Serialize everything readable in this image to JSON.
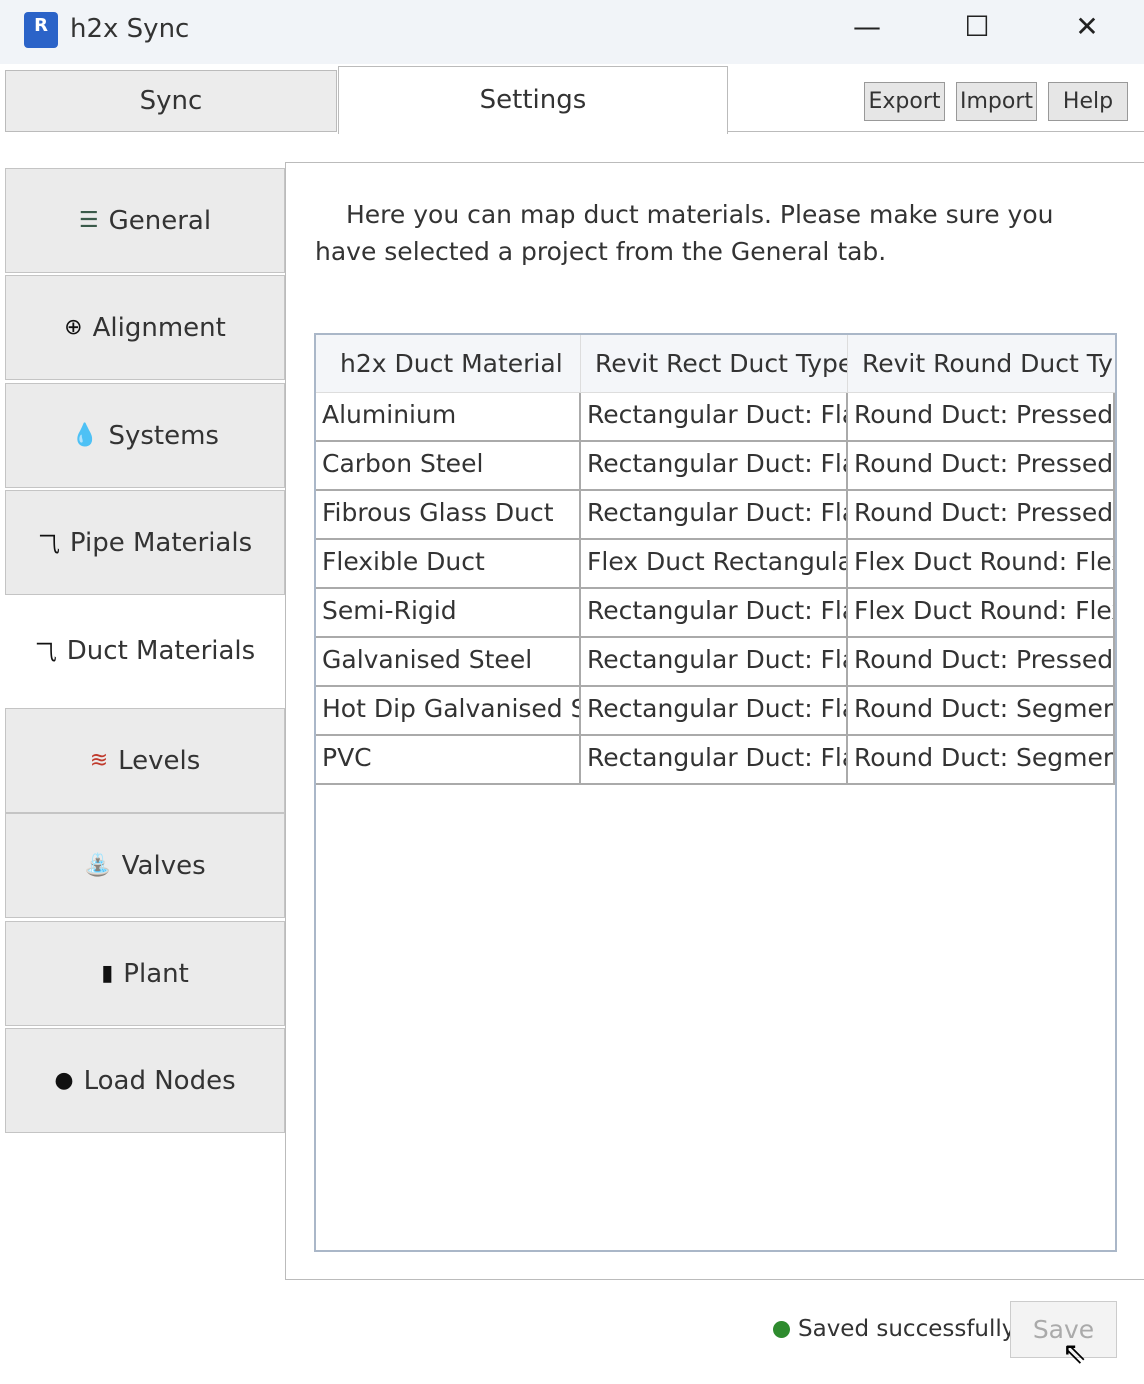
{
  "window": {
    "title": "h2x Sync",
    "app_icon_letter": "R",
    "minimize": "—",
    "maximize": "☐",
    "close": "✕"
  },
  "tabs": [
    {
      "label": "Sync"
    },
    {
      "label": "Settings"
    }
  ],
  "toolbar": {
    "export": "Export",
    "import": "Import",
    "help": "Help"
  },
  "nav": [
    {
      "label": "General",
      "icon": "server-icon",
      "glyph": "☰",
      "color": "#3a5a4a"
    },
    {
      "label": "Alignment",
      "icon": "crosshair-icon",
      "glyph": "⊕",
      "color": "#111"
    },
    {
      "label": "Systems",
      "icon": "water-drop-icon",
      "glyph": "💧",
      "color": "#1a2ee0"
    },
    {
      "label": "Pipe Materials",
      "icon": "pulse-icon",
      "glyph": "⺄",
      "color": "#111"
    },
    {
      "label": "Duct Materials",
      "icon": "pulse-icon",
      "glyph": "⺄",
      "color": "#111"
    },
    {
      "label": "Levels",
      "icon": "layers-icon",
      "glyph": "≋",
      "color": "#c0392b"
    },
    {
      "label": "Valves",
      "icon": "faucet-icon",
      "glyph": "⛲",
      "color": "#111"
    },
    {
      "label": "Plant",
      "icon": "bucket-icon",
      "glyph": "▮",
      "color": "#111"
    },
    {
      "label": "Load Nodes",
      "icon": "circle-icon",
      "glyph": "●",
      "color": "#111"
    }
  ],
  "main": {
    "intro": "Here you can map duct materials. Please make sure you have selected a project from the General tab.",
    "columns": [
      "h2x Duct Material",
      "Revit Rect Duct Type",
      "Revit Round Duct Type"
    ],
    "rows": [
      [
        "Aluminium",
        "Rectangular Duct: Flat",
        "Round Duct: Pressed"
      ],
      [
        "Carbon Steel",
        "Rectangular Duct: Flat",
        "Round Duct: Pressed"
      ],
      [
        "Fibrous Glass Duct",
        "Rectangular Duct: Flat",
        "Round Duct: Pressed"
      ],
      [
        "Flexible Duct",
        "Flex Duct Rectangular",
        "Flex Duct Round: Flex"
      ],
      [
        "Semi-Rigid",
        "Rectangular Duct: Flat",
        "Flex Duct Round: Flex"
      ],
      [
        "Galvanised Steel",
        "Rectangular Duct: Flat",
        "Round Duct: Pressed"
      ],
      [
        "Hot Dip Galvanised Steel",
        "Rectangular Duct: Flat",
        "Round Duct: Segmented"
      ],
      [
        "PVC",
        "Rectangular Duct: Flat",
        "Round Duct: Segmented"
      ]
    ]
  },
  "footer": {
    "status": "Saved successfully",
    "save": "Save"
  }
}
